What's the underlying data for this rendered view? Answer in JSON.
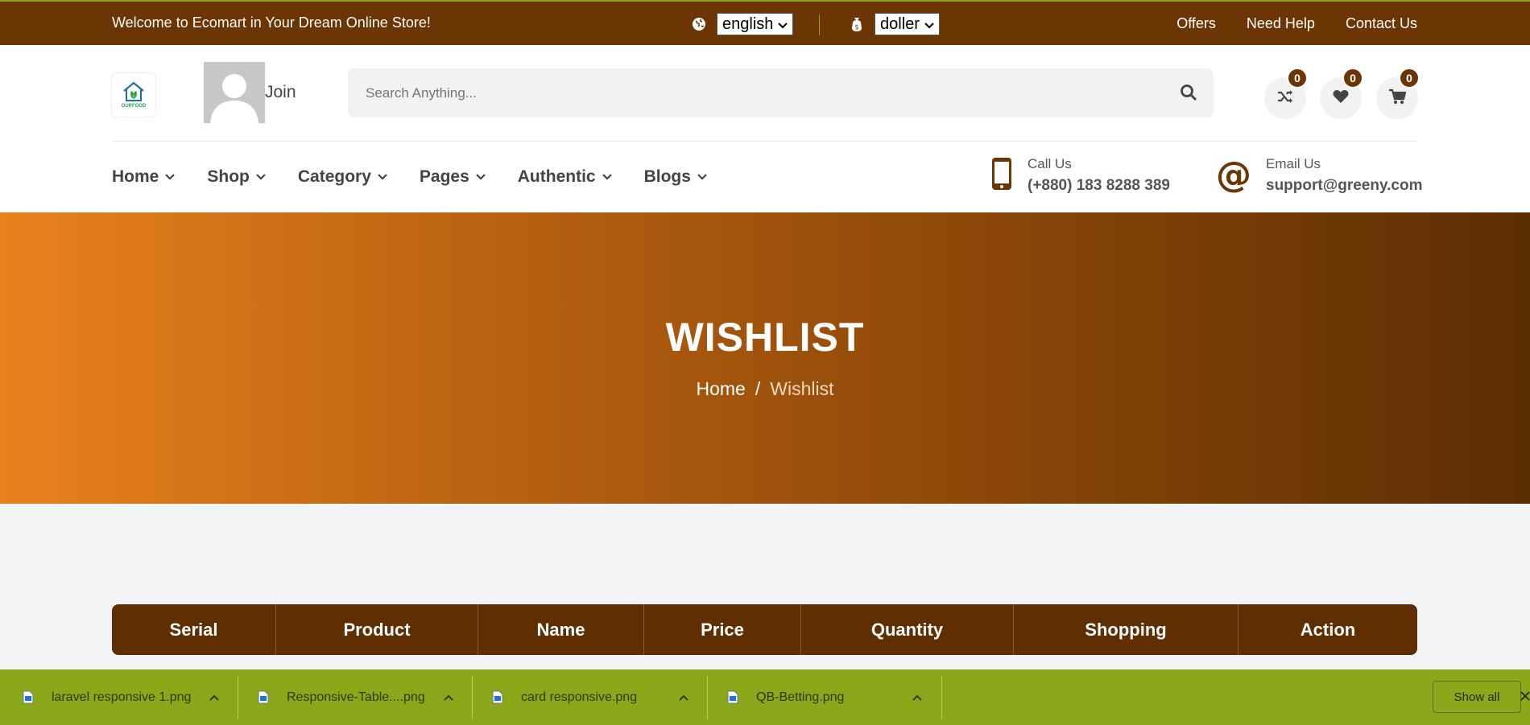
{
  "topbar": {
    "welcome": "Welcome to Ecomart in Your Dream Online Store!",
    "language": "english",
    "currency": "doller",
    "links": [
      "Offers",
      "Need Help",
      "Contact Us"
    ]
  },
  "header": {
    "logo_text": "OURFOOD",
    "join_label": "Join",
    "search_placeholder": "Search Anything...",
    "compare_count": "0",
    "wishlist_count": "0",
    "cart_count": "0"
  },
  "nav": {
    "items": [
      "Home",
      "Shop",
      "Category",
      "Pages",
      "Authentic",
      "Blogs"
    ]
  },
  "contact": {
    "call_label": "Call Us",
    "call_value": "(+880) 183 8288 389",
    "email_label": "Email Us",
    "email_value": "support@greeny.com"
  },
  "hero": {
    "title": "WISHLIST",
    "breadcrumb_home": "Home",
    "breadcrumb_sep": "/",
    "breadcrumb_current": "Wishlist"
  },
  "table": {
    "headers": [
      "Serial",
      "Product",
      "Name",
      "Price",
      "Quantity",
      "Shopping",
      "Action"
    ]
  },
  "downloads": {
    "items": [
      "laravel responsive 1.png",
      "Responsive-Table....png",
      "card responsive.png",
      "QB-Betting.png"
    ],
    "show_all": "Show all"
  },
  "colors": {
    "brand_brown": "#6b3604",
    "accent_orange": "#e8821d",
    "download_bar": "#8ba71a"
  }
}
